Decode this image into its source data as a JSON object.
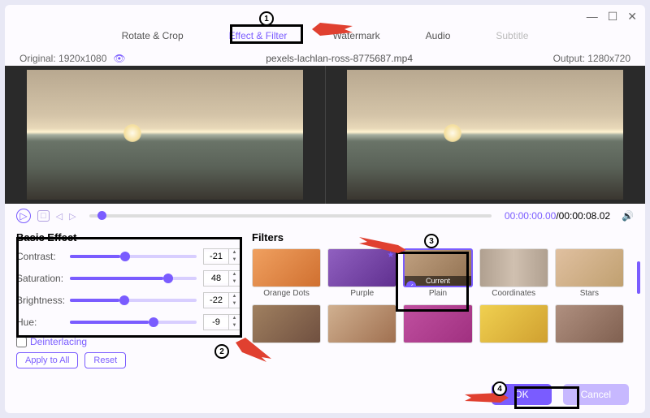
{
  "window": {
    "minimize": "—",
    "maximize": "☐",
    "close": "✕"
  },
  "tabs": {
    "rotate": "Rotate & Crop",
    "effect": "Effect & Filter",
    "watermark": "Watermark",
    "audio": "Audio",
    "subtitle": "Subtitle"
  },
  "infobar": {
    "original_label": "Original:  1920x1080",
    "filename": "pexels-lachlan-ross-8775687.mp4",
    "output_label": "Output:  1280x720"
  },
  "playback": {
    "current_time": "00:00:00.00",
    "total_time": "/00:00:08.02"
  },
  "basic": {
    "title": "Basic Effect",
    "contrast": {
      "label": "Contrast:",
      "value": "-21",
      "pct": 40
    },
    "saturation": {
      "label": "Saturation:",
      "value": "48",
      "pct": 74
    },
    "brightness": {
      "label": "Brightness:",
      "value": "-22",
      "pct": 39
    },
    "hue": {
      "label": "Hue:",
      "value": "-9",
      "pct": 62
    },
    "deinterlacing": "Deinterlacing",
    "apply_all": "Apply to All",
    "reset": "Reset"
  },
  "filters": {
    "title": "Filters",
    "current": "Current",
    "items": [
      "Orange Dots",
      "Purple",
      "Plain",
      "Coordinates",
      "Stars",
      "",
      "",
      "",
      "",
      ""
    ]
  },
  "footer": {
    "ok": "OK",
    "cancel": "Cancel"
  },
  "annotations": {
    "b1": "1",
    "b2": "2",
    "b3": "3",
    "b4": "4"
  }
}
